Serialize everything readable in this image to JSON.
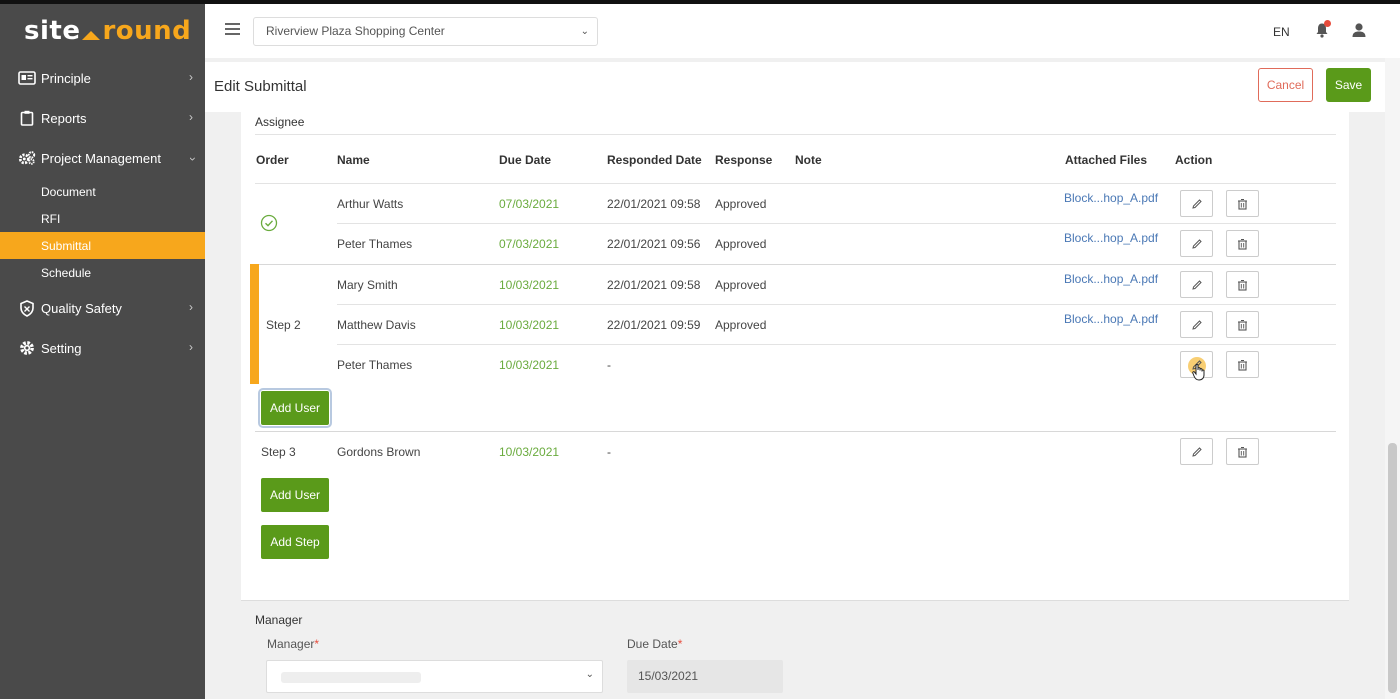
{
  "brand": {
    "part1": "site",
    "part2": "round"
  },
  "sidebar": {
    "items": [
      {
        "label": "Principle",
        "icon": "id-card-icon"
      },
      {
        "label": "Reports",
        "icon": "clipboard-icon"
      },
      {
        "label": "Project Management",
        "icon": "gears-icon"
      },
      {
        "label": "Quality Safety",
        "icon": "shield-icon"
      },
      {
        "label": "Setting",
        "icon": "gear-icon"
      }
    ],
    "sub_items": [
      "Document",
      "RFI",
      "Submittal",
      "Schedule"
    ],
    "active_sub": "Submittal"
  },
  "header": {
    "project": "Riverview Plaza Shopping Center",
    "lang": "EN"
  },
  "page": {
    "title": "Edit Submittal",
    "cancel": "Cancel",
    "save": "Save"
  },
  "assignee": {
    "section": "Assignee",
    "columns": [
      "Order",
      "Name",
      "Due Date",
      "Responded Date",
      "Response",
      "Note",
      "Attached Files",
      "Action"
    ],
    "step1": {
      "rows": [
        {
          "name": "Arthur Watts",
          "due": "07/03/2021",
          "responded": "22/01/2021 09:58",
          "response": "Approved",
          "file": "Block...hop_A.pdf"
        },
        {
          "name": "Peter Thames",
          "due": "07/03/2021",
          "responded": "22/01/2021 09:56",
          "response": "Approved",
          "file": "Block...hop_A.pdf"
        }
      ]
    },
    "step2": {
      "label": "Step 2",
      "rows": [
        {
          "name": "Mary Smith",
          "due": "10/03/2021",
          "responded": "22/01/2021 09:58",
          "response": "Approved",
          "file": "Block...hop_A.pdf"
        },
        {
          "name": "Matthew Davis",
          "due": "10/03/2021",
          "responded": "22/01/2021 09:59",
          "response": "Approved",
          "file": "Block...hop_A.pdf"
        },
        {
          "name": "Peter Thames",
          "due": "10/03/2021",
          "responded": "-",
          "response": "",
          "file": ""
        }
      ]
    },
    "step3": {
      "label": "Step 3",
      "rows": [
        {
          "name": "Gordons Brown",
          "due": "10/03/2021",
          "responded": "-",
          "response": "",
          "file": ""
        }
      ]
    },
    "add_user": "Add User",
    "add_step": "Add Step"
  },
  "manager": {
    "section": "Manager",
    "manager_label": "Manager",
    "due_label": "Due Date",
    "due_value": "15/03/2021",
    "required_mark": "*"
  },
  "colors": {
    "accent": "#f7a71c",
    "primary": "#5a9a1a",
    "danger": "#e06b5a",
    "sidebar": "#4a4a4a"
  }
}
